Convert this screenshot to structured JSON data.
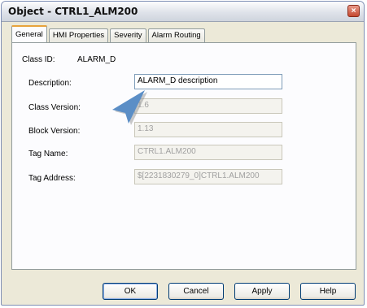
{
  "window": {
    "title": "Object - CTRL1_ALM200",
    "close_glyph": "×"
  },
  "tabs": [
    {
      "label": "General",
      "active": true
    },
    {
      "label": "HMI Properties",
      "active": false
    },
    {
      "label": "Severity",
      "active": false
    },
    {
      "label": "Alarm Routing",
      "active": false
    }
  ],
  "general": {
    "class_id_label": "Class ID:",
    "class_id_value": "ALARM_D",
    "description_label": "Description:",
    "description_value": "ALARM_D description",
    "class_version_label": "Class Version:",
    "class_version_value": "1.6",
    "block_version_label": "Block Version:",
    "block_version_value": "1.13",
    "tag_name_label": "Tag Name:",
    "tag_name_value": "CTRL1.ALM200",
    "tag_address_label": "Tag Address:",
    "tag_address_value": "$[2231830279_0]CTRL1.ALM200"
  },
  "buttons": {
    "ok": "OK",
    "cancel": "Cancel",
    "apply": "Apply",
    "help": "Help"
  },
  "icons": {
    "close": "close-icon",
    "pointer": "pointer-arrow-icon"
  },
  "colors": {
    "pointer": "#5b8ec6",
    "close": "#c4482e"
  }
}
